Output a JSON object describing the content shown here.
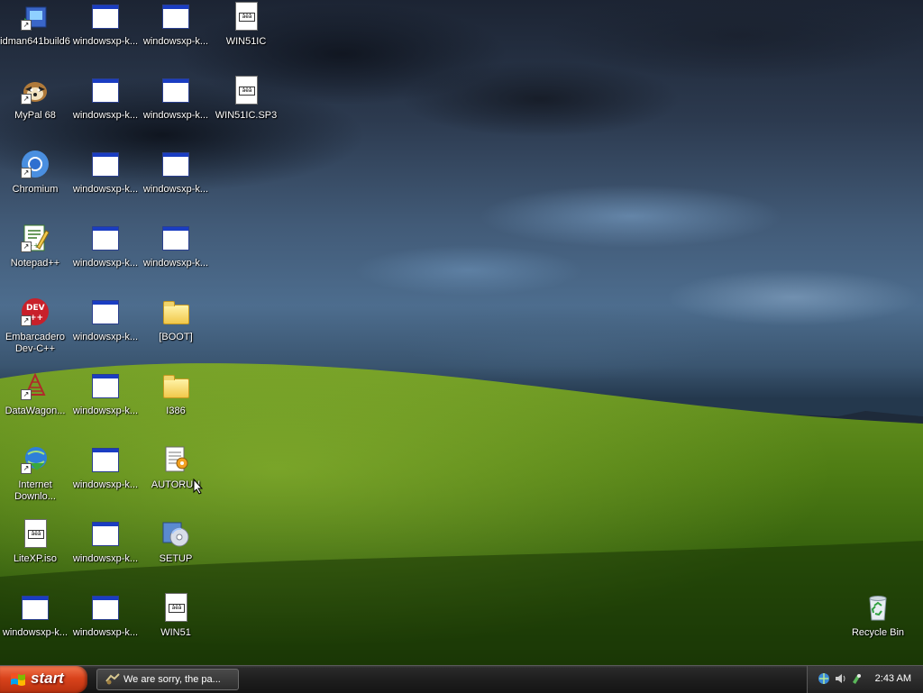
{
  "desktop": {
    "icons": [
      {
        "label": "idman641build6",
        "type": "installer"
      },
      {
        "label": "MyPal 68",
        "type": "mypal"
      },
      {
        "label": "Chromium",
        "type": "chromium"
      },
      {
        "label": "Notepad++",
        "type": "notepadpp"
      },
      {
        "label": "Embarcadero\nDev-C++",
        "type": "devcpp"
      },
      {
        "label": "DataWagon...",
        "type": "datawagon"
      },
      {
        "label": "Internet\nDownlo...",
        "type": "idm"
      },
      {
        "label": "LiteXP.iso",
        "type": "doc"
      },
      {
        "label": "windowsxp-k...",
        "type": "window"
      },
      {
        "label": "windowsxp-k...",
        "type": "window"
      },
      {
        "label": "windowsxp-k...",
        "type": "window"
      },
      {
        "label": "windowsxp-k...",
        "type": "window"
      },
      {
        "label": "windowsxp-k...",
        "type": "window"
      },
      {
        "label": "windowsxp-k...",
        "type": "window"
      },
      {
        "label": "windowsxp-k...",
        "type": "window"
      },
      {
        "label": "windowsxp-k...",
        "type": "window"
      },
      {
        "label": "windowsxp-k...",
        "type": "window"
      },
      {
        "label": "windowsxp-k...",
        "type": "window"
      },
      {
        "label": "windowsxp-k...",
        "type": "window"
      },
      {
        "label": "windowsxp-k...",
        "type": "window"
      },
      {
        "label": "windowsxp-k...",
        "type": "window"
      },
      {
        "label": "windowsxp-k...",
        "type": "window"
      },
      {
        "label": "[BOOT]",
        "type": "folder"
      },
      {
        "label": "I386",
        "type": "folder"
      },
      {
        "label": "AUTORUN",
        "type": "autorun"
      },
      {
        "label": "SETUP",
        "type": "setup"
      },
      {
        "label": "WIN51",
        "type": "doc"
      },
      {
        "label": "WIN51IC",
        "type": "doc"
      },
      {
        "label": "WIN51IC.SP3",
        "type": "doc"
      },
      {
        "label": "Recycle Bin",
        "type": "recycle"
      }
    ]
  },
  "taskbar": {
    "start_label": "start",
    "task_window_label": "We are sorry, the pa...",
    "clock": "2:43 AM"
  }
}
